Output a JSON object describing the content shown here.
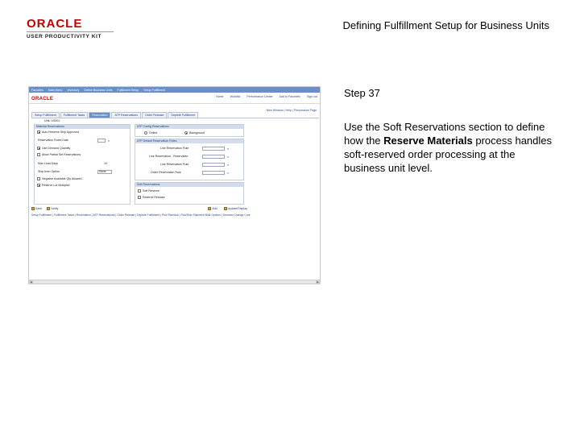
{
  "logo": {
    "brand": "ORACLE",
    "product": "USER PRODUCTIVITY KIT"
  },
  "header": {
    "title": "Defining Fulfillment Setup for Business Units"
  },
  "step": {
    "label": "Step 37",
    "text_before": "Use the Soft Reservations section to define how the ",
    "bold": "Reserve Materials",
    "text_after": " process handles soft-reserved order processing at the business unit level."
  },
  "screenshot": {
    "nav": [
      "Favorites",
      "Main Menu",
      "Inventory",
      "Define Business Units",
      "Fulfillment Setup",
      "Setup Fulfillment"
    ],
    "minilogo": "ORACLE",
    "top_links": [
      "Home",
      "Worklist",
      "Performance Center",
      "Add to Favorites",
      "Sign out"
    ],
    "page_links": "New Window | Help | Personalize Page",
    "tabs": [
      "Setup Fulfillment",
      "Fulfillment Tasks",
      "Reservation",
      "ATP Reservations",
      "Order Release",
      "Deplete Fulfillment"
    ],
    "unit_label": "Unit: US001",
    "material_reservation": {
      "header": "Material Reservations",
      "auto_release": "Auto Reserve Ship Approved",
      "reservation_rules": "Reservation Rules Date",
      "use_demand_quantity": "Use Demand Quantity",
      "allow_partial": "Allow Partial Set Reservations",
      "max_lead_days": "Max Lead Days",
      "max_lead_value": "10",
      "ship_from_option": "Ship from Option",
      "ship_from_value": "None",
      "negative_allowed": "Negative Available Qty Allowed",
      "reserve_multiples": "Reserve Lot Multiples"
    },
    "atp_config": {
      "header": "ATP Config Reservations",
      "online": "Online",
      "background": "Background"
    },
    "atp_defaults": {
      "header": "ATP Default Reservation Rules",
      "rows": [
        "Line Reservation Rule",
        "Line Reservation - Reservable",
        "Line Reservation Rule",
        "Order Reservation Rule"
      ]
    },
    "soft_reservations": {
      "header": "Soft Reservations",
      "soft_reserve": "Soft Reserve",
      "reserve_release": "Reserve Release"
    },
    "buttons": {
      "save": "Save",
      "notify": "Notify",
      "add": "Add",
      "update": "Update/Display"
    },
    "footer_links": "Setup Fulfillment | Fulfillment Tasks | Reservation | ATP Reservations | Order Release | Deplete Fulfillment | Pick Plan/Ack | Pick/Ship Shipment Bulk Options | Demand Change Cont"
  }
}
